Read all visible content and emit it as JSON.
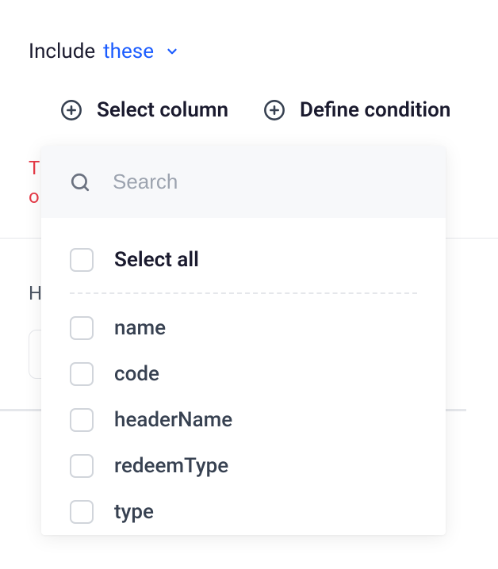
{
  "header": {
    "include_label": "Include",
    "dropdown_value": "these"
  },
  "actions": {
    "select_column": "Select column",
    "define_condition": "Define condition"
  },
  "error": {
    "line1": "T",
    "line2": "o"
  },
  "behind": {
    "h_label": "H"
  },
  "dropdown": {
    "search_placeholder": "Search",
    "select_all": "Select all",
    "options": [
      "name",
      "code",
      "headerName",
      "redeemType",
      "type"
    ]
  }
}
